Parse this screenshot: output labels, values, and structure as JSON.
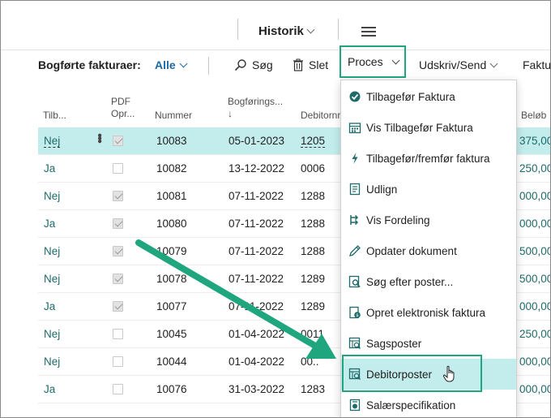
{
  "header": {
    "title": "Historik",
    "menu_icon": "hamburger-icon"
  },
  "actionbar": {
    "view_label": "Bogførte fakturaer:",
    "view_value": "Alle",
    "search_label": "Søg",
    "delete_label": "Slet",
    "proces_label": "Proces",
    "print_label": "Udskriv/Send",
    "overflow_label": "Faktu"
  },
  "columns": {
    "tilb": "Tilb...",
    "pdf_line1": "PDF",
    "pdf_line2": "Opr...",
    "nummer": "Nummer",
    "bogf": "Bogførings...",
    "bogf_sort": "↓",
    "debitor": "Debitornr.",
    "belob": "Beløb"
  },
  "rows": [
    {
      "tilb": "Nej",
      "pdf": true,
      "nummer": "10083",
      "dato": "05-01-2023",
      "debitor": "1205",
      "belob": "375,00"
    },
    {
      "tilb": "Ja",
      "pdf": false,
      "nummer": "10082",
      "dato": "13-12-2022",
      "debitor": "0006",
      "belob": "250,00"
    },
    {
      "tilb": "Nej",
      "pdf": true,
      "nummer": "10081",
      "dato": "07-11-2022",
      "debitor": "1288",
      "belob": "000,00"
    },
    {
      "tilb": "Ja",
      "pdf": true,
      "nummer": "10080",
      "dato": "07-11-2022",
      "debitor": "1288",
      "belob": "000,00"
    },
    {
      "tilb": "Nej",
      "pdf": true,
      "nummer": "10079",
      "dato": "07-11-2022",
      "debitor": "1288",
      "belob": "500,00"
    },
    {
      "tilb": "Nej",
      "pdf": true,
      "nummer": "10078",
      "dato": "07-11-2022",
      "debitor": "1289",
      "belob": "500,00"
    },
    {
      "tilb": "Ja",
      "pdf": true,
      "nummer": "10077",
      "dato": "07-11-2022",
      "debitor": "1289",
      "belob": "000,00"
    },
    {
      "tilb": "Nej",
      "pdf": false,
      "nummer": "10045",
      "dato": "01-04-2022",
      "debitor": "0011",
      "belob": "250,00"
    },
    {
      "tilb": "Nej",
      "pdf": false,
      "nummer": "10044",
      "dato": "01-04-2022",
      "debitor": "00..",
      "belob": "000,00"
    },
    {
      "tilb": "Ja",
      "pdf": false,
      "nummer": "10076",
      "dato": "31-03-2022",
      "debitor": "1283",
      "belob": "000,00"
    }
  ],
  "menu": {
    "items": [
      {
        "label": "Tilbagefør Faktura",
        "icon": "reverse-invoice-icon"
      },
      {
        "label": "Vis Tilbagefør Faktura",
        "icon": "calendar-grid-icon"
      },
      {
        "label": "Tilbagefør/fremfør faktura",
        "icon": "lightning-icon"
      },
      {
        "label": "Udlign",
        "icon": "apply-document-icon"
      },
      {
        "label": "Vis Fordeling",
        "icon": "distribution-icon"
      },
      {
        "label": "Opdater dokument",
        "icon": "pencil-icon"
      },
      {
        "label": "Søg efter poster...",
        "icon": "find-entries-icon"
      },
      {
        "label": "Opret elektronisk faktura",
        "icon": "e-invoice-icon"
      },
      {
        "label": "Sagsposter",
        "icon": "ledger-search-icon"
      },
      {
        "label": "Debitorposter",
        "icon": "ledger-search-icon"
      },
      {
        "label": "Salærspecifikation",
        "icon": "specification-icon"
      }
    ],
    "highlighted_index": 9
  },
  "colors": {
    "accent_green": "#20a67f",
    "selected_row": "#c3ecec",
    "link_blue": "#1f6aa5"
  }
}
